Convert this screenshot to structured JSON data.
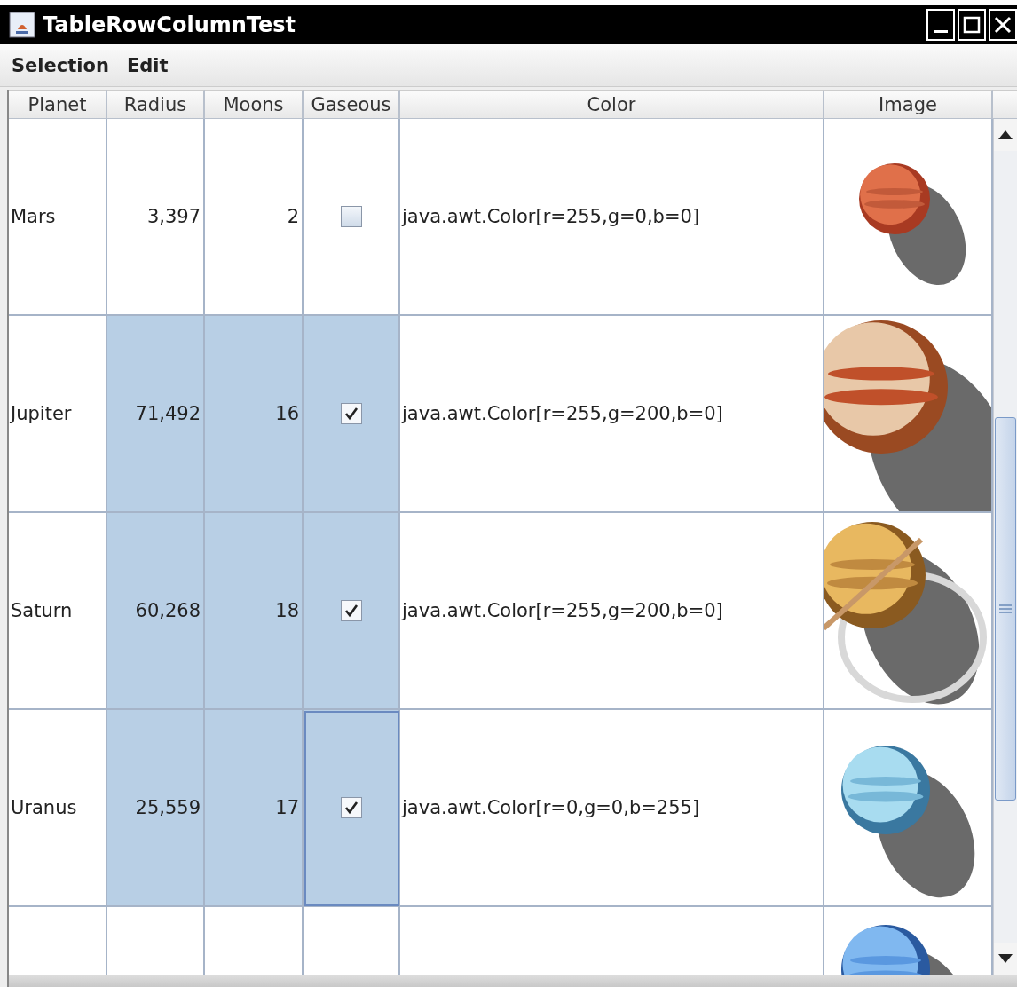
{
  "window": {
    "title": "TableRowColumnTest"
  },
  "menu": [
    "Selection",
    "Edit"
  ],
  "table": {
    "columns": [
      "Planet",
      "Radius",
      "Moons",
      "Gaseous",
      "Color",
      "Image"
    ],
    "rows": [
      {
        "planet": {
          "text": "Mars",
          "selected": false
        },
        "radius": {
          "text": "3,397",
          "selected": false
        },
        "moons": {
          "text": "2",
          "selected": false
        },
        "gaseous": {
          "checked": false,
          "selected": false,
          "focused": false
        },
        "color": {
          "text": "java.awt.Color[r=255,g=0,b=0]",
          "selected": false
        },
        "image": {
          "kind": "picture"
        }
      },
      {
        "planet": {
          "text": "Jupiter",
          "selected": false
        },
        "radius": {
          "text": "71,492",
          "selected": true
        },
        "moons": {
          "text": "16",
          "selected": true
        },
        "gaseous": {
          "checked": true,
          "selected": true,
          "focused": false
        },
        "color": {
          "text": "java.awt.Color[r=255,g=200,b=0]",
          "selected": false
        },
        "image": {
          "kind": "picture"
        }
      },
      {
        "planet": {
          "text": "Saturn",
          "selected": false
        },
        "radius": {
          "text": "60,268",
          "selected": true
        },
        "moons": {
          "text": "18",
          "selected": true
        },
        "gaseous": {
          "checked": true,
          "selected": true,
          "focused": false
        },
        "color": {
          "text": "java.awt.Color[r=255,g=200,b=0]",
          "selected": false
        },
        "image": {
          "kind": "picture"
        }
      },
      {
        "planet": {
          "text": "Uranus",
          "selected": false
        },
        "radius": {
          "text": "25,559",
          "selected": true
        },
        "moons": {
          "text": "17",
          "selected": true
        },
        "gaseous": {
          "checked": true,
          "selected": true,
          "focused": true
        },
        "color": {
          "text": "java.awt.Color[r=0,g=0,b=255]",
          "selected": false
        },
        "image": {
          "kind": "picture"
        }
      },
      {
        "image": {
          "kind": "picture"
        }
      }
    ]
  }
}
